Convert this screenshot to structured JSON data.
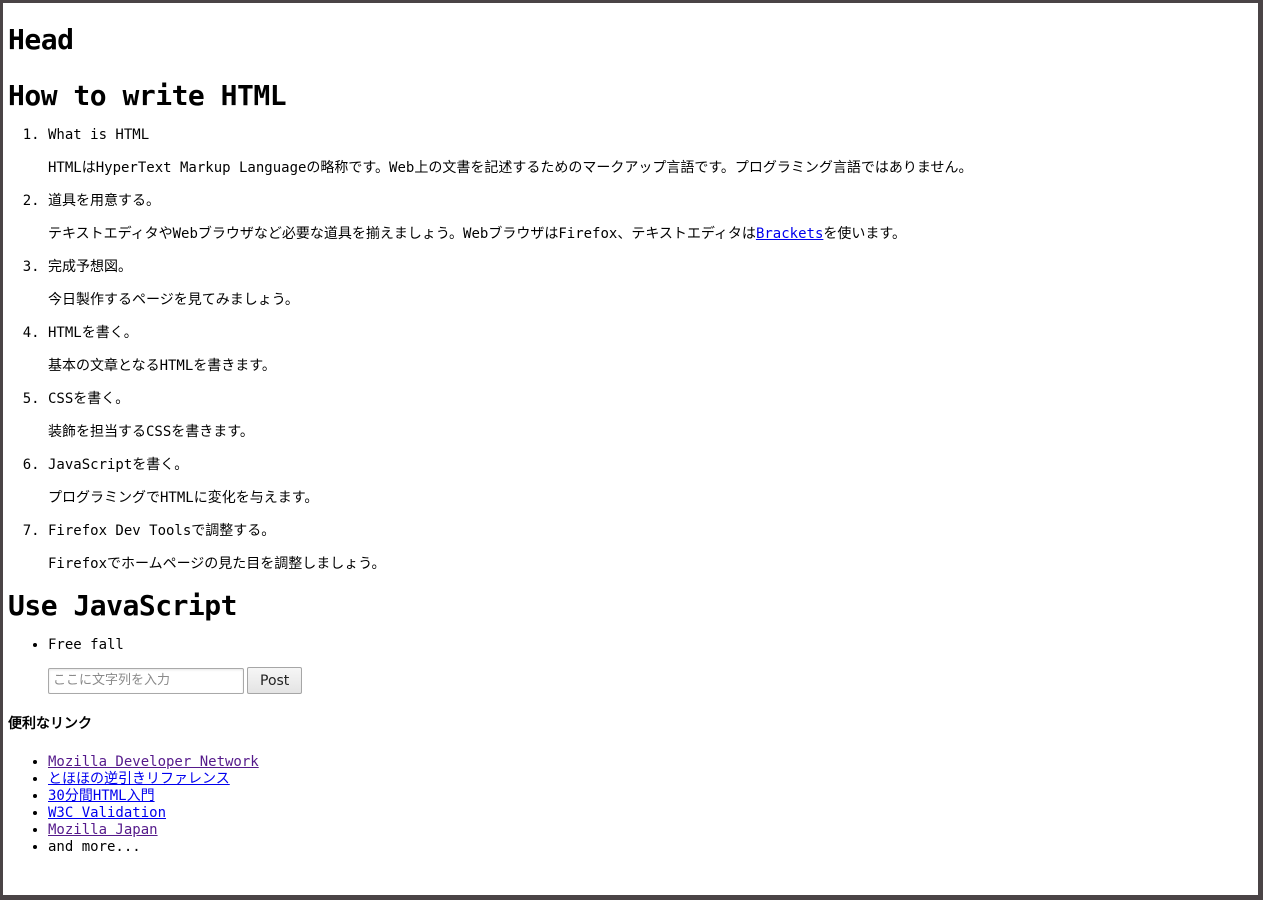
{
  "head_title": "Head",
  "sections": {
    "howto_title": "How to write HTML",
    "use_js_title": "Use JavaScript"
  },
  "steps": [
    {
      "title": "What is HTML",
      "desc": "HTMLはHyperText Markup Languageの略称です。Web上の文書を記述するためのマークアップ言語です。プログラミング言語ではありません。"
    },
    {
      "title": "道具を用意する。",
      "desc_before": "テキストエディタやWebブラウザなど必要な道具を揃えましょう。WebブラウザはFirefox、テキストエディタは",
      "desc_link": "Brackets",
      "desc_after": "を使います。"
    },
    {
      "title": "完成予想図。",
      "desc": "今日製作するページを見てみましょう。"
    },
    {
      "title": "HTMLを書く。",
      "desc": "基本の文章となるHTMLを書きます。"
    },
    {
      "title": "CSSを書く。",
      "desc": "装飾を担当するCSSを書きます。"
    },
    {
      "title": "JavaScriptを書く。",
      "desc": "プログラミングでHTMLに変化を与えます。"
    },
    {
      "title": "Firefox Dev Toolsで調整する。",
      "desc": "Firefoxでホームページの見た目を調整しましょう。"
    }
  ],
  "use_js": {
    "items": [
      "Free fall"
    ],
    "input_placeholder": "ここに文字列を入力",
    "input_value": "",
    "post_label": "Post"
  },
  "links_section": {
    "title": "便利なリンク",
    "items": [
      {
        "label": "Mozilla Developer Network",
        "visited": true
      },
      {
        "label": "とほほの逆引きリファレンス",
        "visited": false
      },
      {
        "label": "30分間HTML入門",
        "visited": false
      },
      {
        "label": "W3C Validation",
        "visited": false
      },
      {
        "label": "Mozilla Japan",
        "visited": true
      }
    ],
    "more_text": "and more..."
  },
  "colors": {
    "link": "#0000ee",
    "visited_link": "#551a8b",
    "window_border": "#4a4446"
  }
}
